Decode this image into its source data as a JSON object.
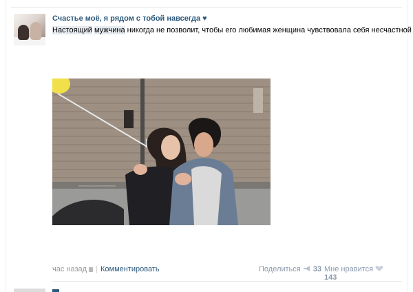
{
  "post": {
    "author": "Счастье моё, я рядом с тобой навсегда ♥",
    "text_highlight_1": "Настоящий",
    "text_space": " ",
    "text_highlight_2": "мужчина",
    "text_rest": " никогда не позволит, чтобы его любимая женщина чувствовала себя несчастной",
    "footer": {
      "time": "час назад",
      "separator": "|",
      "comment_label": "Комментировать",
      "share_label": "Поделиться",
      "share_count": "33",
      "like_label": "Мне нравится",
      "like_count": "143"
    },
    "icons": {
      "lock": "lock-icon",
      "share": "megaphone-icon",
      "like": "heart-icon"
    }
  },
  "colors": {
    "link": "#2b587a",
    "muted": "#999999",
    "action": "#8a99ad"
  }
}
